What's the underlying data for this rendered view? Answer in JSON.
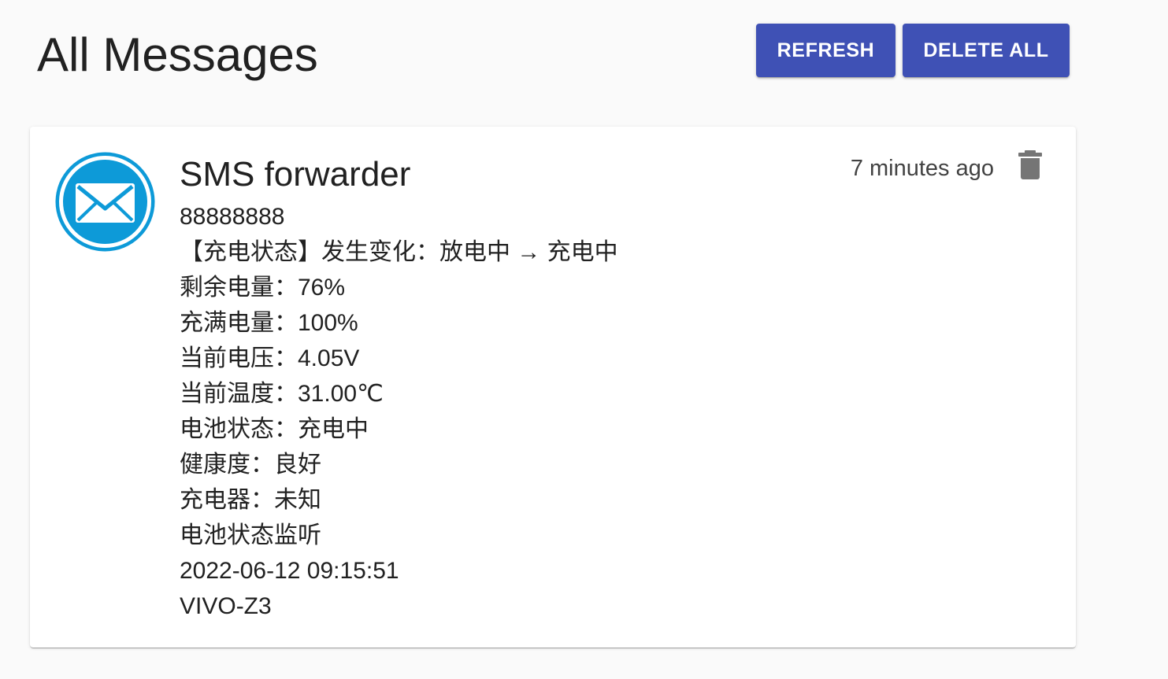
{
  "header": {
    "title": "All Messages",
    "refresh_label": "REFRESH",
    "delete_all_label": "DELETE ALL"
  },
  "colors": {
    "primary": "#3f51b5",
    "avatar": "#0d9ad8",
    "delete_icon": "#757575"
  },
  "message": {
    "avatar_icon": "envelope-icon",
    "title": "SMS forwarder",
    "timestamp": "7 minutes ago",
    "delete_icon": "trash-icon",
    "lines": [
      "88888888",
      "【充电状态】发生变化：放电中 → 充电中",
      "剩余电量：76%",
      "充满电量：100%",
      "当前电压：4.05V",
      "当前温度：31.00℃",
      "电池状态：充电中",
      "健康度：良好",
      "充电器：未知",
      "电池状态监听",
      "2022-06-12 09:15:51",
      "VIVO-Z3"
    ]
  }
}
